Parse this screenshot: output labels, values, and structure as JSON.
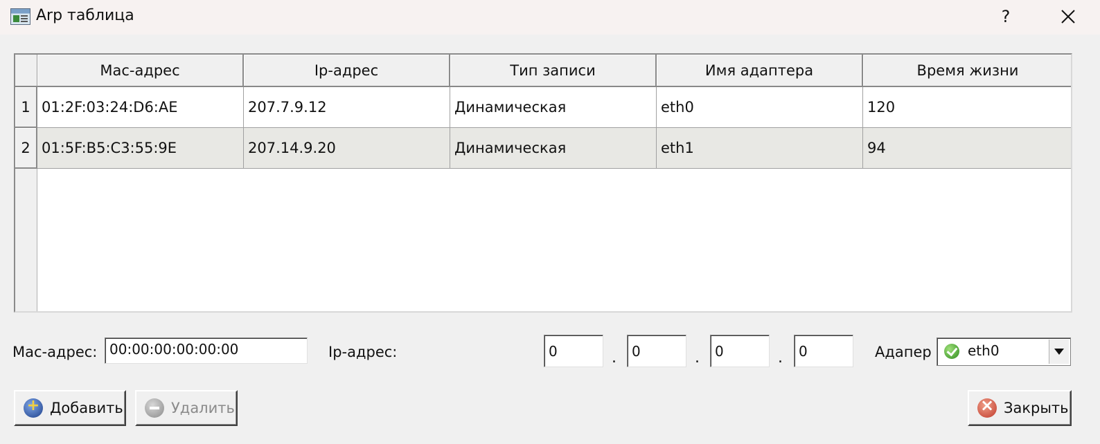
{
  "window": {
    "title": "Arp таблица",
    "help": "?"
  },
  "table": {
    "columns": [
      "Mac-адрес",
      "Ip-адрес",
      "Тип записи",
      "Имя адаптера",
      "Время жизни"
    ],
    "rows": [
      {
        "num": "1",
        "cells": [
          "01:2F:03:24:D6:AE",
          "207.7.9.12",
          "Динамическая",
          "eth0",
          "120"
        ]
      },
      {
        "num": "2",
        "cells": [
          "01:5F:B5:C3:55:9E",
          "207.14.9.20",
          "Динамическая",
          "eth1",
          "94"
        ]
      }
    ]
  },
  "form": {
    "mac_label": "Mac-адрес:",
    "mac_value": "00:00:00:00:00:00",
    "ip_label": "Ip-адрес:",
    "ip_octets": [
      "0",
      "0",
      "0",
      "0"
    ],
    "dot": ".",
    "adapter_label": "Адапер",
    "adapter_value": "eth0"
  },
  "buttons": {
    "add": "Добавить",
    "remove": "Удалить",
    "close": "Закрыть"
  },
  "icons": {
    "app": "app-table-icon",
    "help": "help-icon",
    "close": "close-icon",
    "adapter": "check-circle-icon",
    "dropdown": "chevron-down-icon",
    "add": "plus-circle-icon",
    "remove": "minus-circle-icon",
    "close_button": "cross-circle-icon"
  }
}
